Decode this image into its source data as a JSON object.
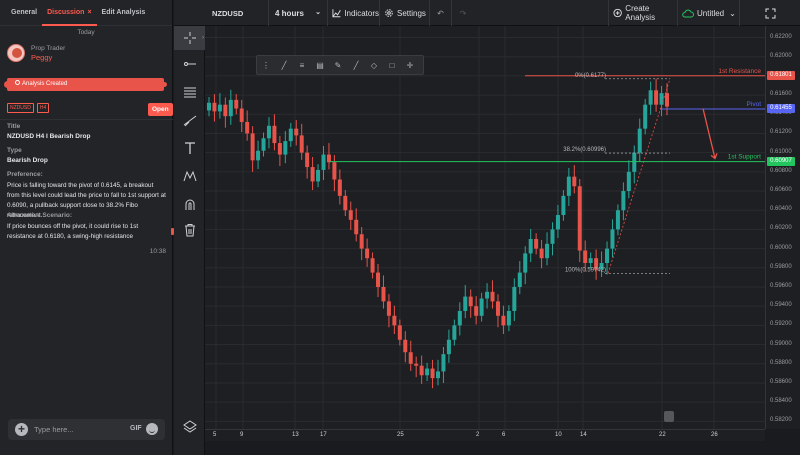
{
  "sidebar": {
    "tabs": [
      "General",
      "Discussion",
      "Edit Analysis"
    ],
    "close_glyph": "×",
    "today": "Today",
    "user_role": "Prop Trader",
    "user_name": "Peggy",
    "analysis_created": "Analysis Created",
    "tags": [
      "NZDUSD",
      "H4"
    ],
    "open_label": "Open",
    "title_label": "Title",
    "title_value": "NZDUSD H4 I Bearish Drop",
    "type_label": "Type",
    "type_value": "Bearish Drop",
    "preference_label": "Preference:",
    "preference_text": "Price is falling toward the pivot of 0.6145, a breakout from this level could lead the price to fall to 1st support at 0.6090, a pullback support close to 38.2% Fibo retracement.",
    "alt_label": "Alternative Scenario:",
    "alt_text": "If price bounces off the pivot, it could rise to 1st resistance at 0.6180, a swing-high resistance",
    "time": "10:38",
    "chat_placeholder": "Type here...",
    "gif_label": "GIF"
  },
  "topbar": {
    "symbol": "NZDUSD",
    "timeframe": "4 hours",
    "indicators": "Indicators",
    "settings": "Settings",
    "create_analysis": "Create Analysis",
    "layout_name": "Untitled"
  },
  "toolbar_icons": [
    "crosshair-icon",
    "horizontal-ray-icon",
    "fib-levels-icon",
    "trend-line-icon",
    "text-icon",
    "pattern-icon",
    "magnet-icon",
    "trash-icon",
    "layers-icon"
  ],
  "chart_data": {
    "type": "candlestick",
    "symbol": "NZDUSD",
    "y_ticks": [
      "0.62200",
      "0.62000",
      "0.61800",
      "0.61600",
      "0.61400",
      "0.61200",
      "0.61000",
      "0.60800",
      "0.60600",
      "0.60400",
      "0.60200",
      "0.60000",
      "0.59800",
      "0.59600",
      "0.59400",
      "0.59200",
      "0.59000",
      "0.58800",
      "0.58600",
      "0.58400",
      "0.58200"
    ],
    "x_ticks": [
      "5",
      "9",
      "13",
      "17",
      "25",
      "2",
      "6",
      "10",
      "14",
      "22",
      "26"
    ],
    "ylim": [
      0.5812,
      0.6232
    ],
    "levels": [
      {
        "name": "1st Resistance",
        "price": "0.61801",
        "color": "#e8534a"
      },
      {
        "name": "Pivot",
        "price": "0.61455",
        "color": "#5865f2"
      },
      {
        "name": "1st Support",
        "price": "0.60907",
        "color": "#22c55e"
      }
    ],
    "fib_labels": [
      "0%(0.6177)",
      "38.2%(0.60996)",
      "100%(0.59742)"
    ],
    "closes": [
      0.6152,
      0.6143,
      0.615,
      0.6138,
      0.6155,
      0.6146,
      0.6132,
      0.612,
      0.6092,
      0.6102,
      0.6115,
      0.6128,
      0.611,
      0.6098,
      0.6112,
      0.6125,
      0.6118,
      0.61,
      0.6085,
      0.607,
      0.6082,
      0.6098,
      0.609,
      0.6072,
      0.6055,
      0.604,
      0.603,
      0.6015,
      0.6,
      0.599,
      0.5975,
      0.596,
      0.5945,
      0.593,
      0.592,
      0.5905,
      0.5892,
      0.588,
      0.5878,
      0.5868,
      0.5875,
      0.5865,
      0.5872,
      0.589,
      0.5905,
      0.592,
      0.5935,
      0.595,
      0.594,
      0.593,
      0.5948,
      0.5955,
      0.5945,
      0.593,
      0.592,
      0.5935,
      0.596,
      0.5975,
      0.5995,
      0.601,
      0.6,
      0.599,
      0.6005,
      0.602,
      0.6035,
      0.6055,
      0.6075,
      0.6065,
      0.5998,
      0.5985,
      0.599,
      0.5978,
      0.5985,
      0.6,
      0.602,
      0.604,
      0.606,
      0.608,
      0.61,
      0.6125,
      0.615,
      0.6165,
      0.615,
      0.6162,
      0.6148
    ]
  }
}
